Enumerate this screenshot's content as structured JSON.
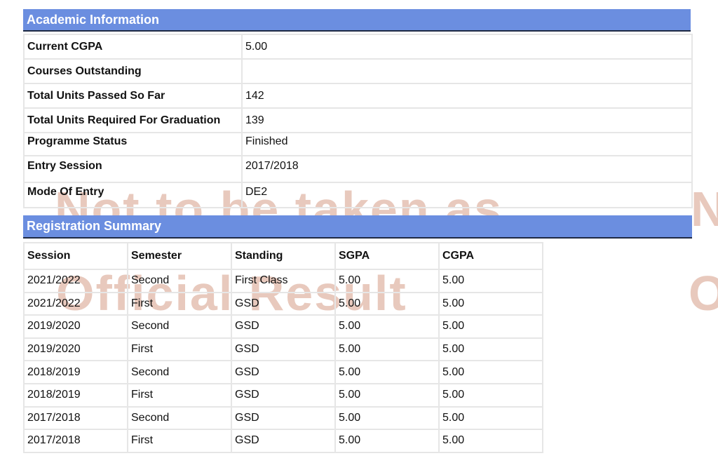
{
  "academic_information": {
    "title": "Academic Information",
    "rows": [
      {
        "label": "Current CGPA",
        "value": "5.00"
      },
      {
        "label": "Courses Outstanding",
        "value": ""
      },
      {
        "label": "Total Units Passed So Far",
        "value": "142"
      },
      {
        "label": "Total Units Required For Graduation",
        "value": "139"
      },
      {
        "label": "Programme Status",
        "value": "Finished"
      },
      {
        "label": "Entry Session",
        "value": "2017/2018"
      },
      {
        "label": "Mode Of Entry",
        "value": "DE2"
      }
    ]
  },
  "registration_summary": {
    "title": "Registration Summary",
    "columns": [
      "Session",
      "Semester",
      "Standing",
      "SGPA",
      "CGPA"
    ],
    "rows": [
      [
        "2021/2022",
        "Second",
        "First Class",
        "5.00",
        "5.00"
      ],
      [
        "2021/2022",
        "First",
        "GSD",
        "5.00",
        "5.00"
      ],
      [
        "2019/2020",
        "Second",
        "GSD",
        "5.00",
        "5.00"
      ],
      [
        "2019/2020",
        "First",
        "GSD",
        "5.00",
        "5.00"
      ],
      [
        "2018/2019",
        "Second",
        "GSD",
        "5.00",
        "5.00"
      ],
      [
        "2018/2019",
        "First",
        "GSD",
        "5.00",
        "5.00"
      ],
      [
        "2017/2018",
        "Second",
        "GSD",
        "5.00",
        "5.00"
      ],
      [
        "2017/2018",
        "First",
        "GSD",
        "5.00",
        "5.00"
      ]
    ]
  },
  "watermark": {
    "line1": "Not to be taken as",
    "line2": "Official Result",
    "trailing1": "N",
    "trailing2": "O"
  },
  "colors": {
    "header_bg": "#6b8ee0",
    "header_text": "#ffffff",
    "watermark": "#e8c9bd",
    "border": "#e6e6e6"
  }
}
